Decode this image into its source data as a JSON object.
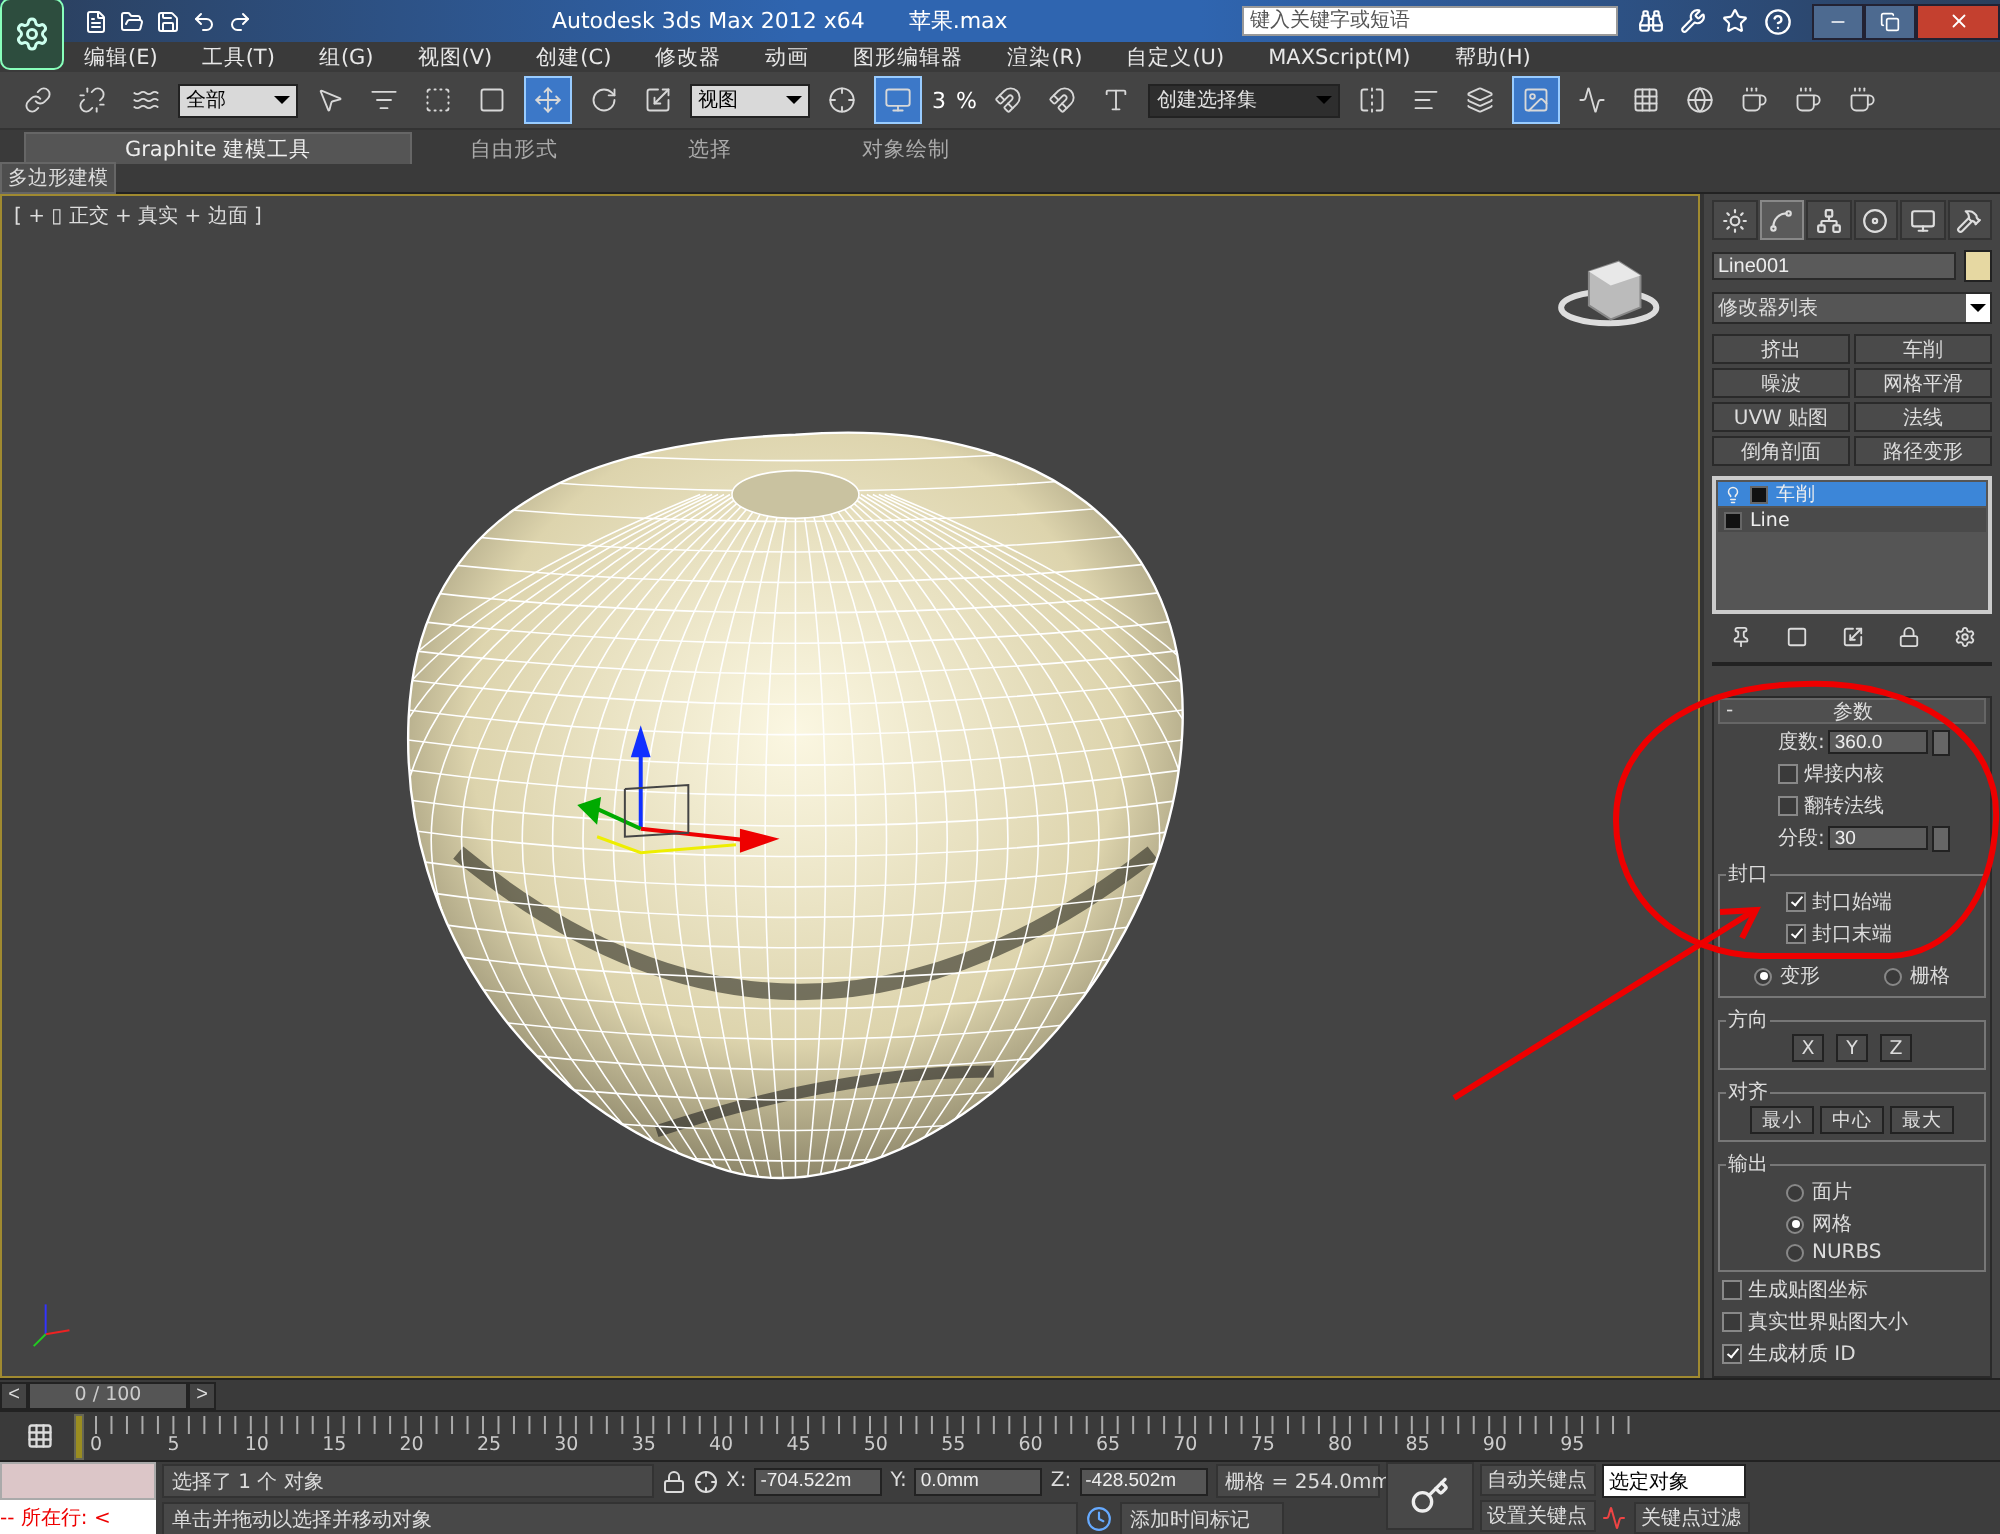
{
  "title_bar": {
    "title": "Autodesk 3ds Max  2012 x64",
    "file": "苹果.max",
    "search": {
      "placeholder": "键入关键字或短语"
    }
  },
  "menu": [
    "编辑(E)",
    "工具(T)",
    "组(G)",
    "视图(V)",
    "创建(C)",
    "修改器",
    "动画",
    "图形编辑器",
    "渲染(R)",
    "自定义(U)",
    "MAXScript(M)",
    "帮助(H)"
  ],
  "toolbar": {
    "selection_filter": "全部",
    "reference_coord": "视图",
    "snap_label": "3",
    "percent_label": "%",
    "named_selection": "创建选择集"
  },
  "ribbon": {
    "tabs": [
      {
        "label": "Graphite 建模工具",
        "selected": true
      },
      {
        "label": "自由形式",
        "selected": false
      },
      {
        "label": "选择",
        "selected": false
      },
      {
        "label": "对象绘制",
        "selected": false
      }
    ],
    "panel": "多边形建模"
  },
  "viewport": {
    "label": "[ + ▯ 正交 + 真实 + 边面 ]"
  },
  "command_panel": {
    "tabs": [
      {
        "kind": "create",
        "selected": false
      },
      {
        "kind": "modify",
        "selected": true
      },
      {
        "kind": "hierarchy",
        "selected": false
      },
      {
        "kind": "motion",
        "selected": false
      },
      {
        "kind": "display",
        "selected": false
      },
      {
        "kind": "utilities",
        "selected": false
      }
    ],
    "object_name": "Line001",
    "modifier_list": "修改器列表",
    "modifier_buttons": [
      "挤出",
      "车削",
      "噪波",
      "网格平滑",
      "UVW 贴图",
      "法线",
      "倒角剖面",
      "路径变形"
    ],
    "stack": [
      {
        "kind": "modifier",
        "label": "车削",
        "selected": true
      },
      {
        "kind": "base",
        "label": "Line",
        "selected": false
      }
    ],
    "rollout": {
      "toggle": "-",
      "title": "参数",
      "degrees": {
        "label": "度数:",
        "value": "360.0"
      },
      "checks": [
        {
          "label": "焊接内核",
          "checked": false
        },
        {
          "label": "翻转法线",
          "checked": false
        }
      ],
      "segments": {
        "label": "分段:",
        "value": "30"
      },
      "capping": {
        "title": "封口",
        "checks": [
          {
            "label": "封口始端",
            "checked": true
          },
          {
            "label": "封口末端",
            "checked": true
          }
        ],
        "radios": [
          {
            "label": "变形",
            "selected": true
          },
          {
            "label": "栅格",
            "selected": false
          }
        ]
      },
      "direction": {
        "title": "方向",
        "buttons": [
          "X",
          "Y",
          "Z"
        ]
      },
      "align": {
        "title": "对齐",
        "buttons": [
          "最小",
          "中心",
          "最大"
        ]
      },
      "output": {
        "title": "输出",
        "radios": [
          {
            "label": "面片",
            "selected": false
          },
          {
            "label": "网格",
            "selected": true
          },
          {
            "label": "NURBS",
            "selected": false
          }
        ]
      },
      "bottom_checks": [
        {
          "label": "生成贴图坐标",
          "checked": false
        },
        {
          "label": "真实世界贴图大小",
          "checked": false
        },
        {
          "label": "生成材质 ID",
          "checked": true
        }
      ]
    }
  },
  "timeline": {
    "prev": "<",
    "frame": "0 / 100",
    "next": ">",
    "ticks": [
      "0",
      "5",
      "10",
      "15",
      "20",
      "25",
      "30",
      "35",
      "40",
      "45",
      "50",
      "55",
      "60",
      "65",
      "70",
      "75",
      "80",
      "85",
      "90",
      "95"
    ]
  },
  "status": {
    "listener_text": "--   所在行:  <",
    "prompt": "选择了 1 个 对象",
    "hint": "单击并拖动以选择并移动对象",
    "x_label": "X:",
    "x": "-704.522m",
    "y_label": "Y:",
    "y": "0.0mm",
    "z_label": "Z:",
    "z": "-428.502m",
    "grid": "栅格 = 254.0mm",
    "add_time_tag": "添加时间标记",
    "auto_key": "自动关键点",
    "set_key": "设置关键点",
    "key_mode": "选定对象",
    "key_filters": "关键点过滤"
  }
}
